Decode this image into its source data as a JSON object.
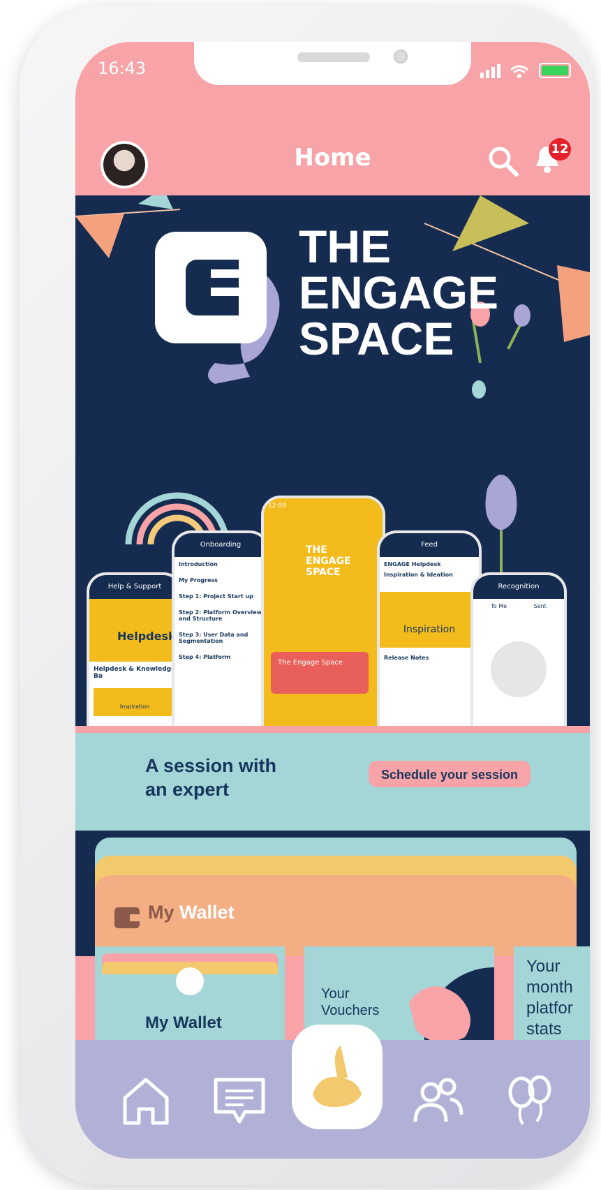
{
  "status_bar": {
    "time": "16:43",
    "battery_color": "#3bd35b"
  },
  "header": {
    "title": "Home",
    "notification_count": "12"
  },
  "hero": {
    "title_lines": [
      "THE",
      "ENGAGE",
      "SPACE"
    ],
    "mockups": [
      {
        "title": "Help & Support",
        "headline": "Helpdesk",
        "subtitle": "Helpdesk & Knowledge Ba",
        "note": "Inspiration"
      },
      {
        "title": "Onboarding",
        "items": [
          "Introduction",
          "My Progress",
          "Step 1: Project Start up",
          "Step 2: Platform Overview and Structure",
          "Step 3: User Data and Segmentation",
          "Step 4: Platform"
        ]
      },
      {
        "title": "12:09",
        "brand_lines": [
          "THE",
          "ENGAGE",
          "SPACE"
        ],
        "promo": "The Engage Space"
      },
      {
        "title": "Feed",
        "author": "ENGAGE Helpdesk",
        "topic": "Inspiration & Ideation",
        "card_label": "Inspiration",
        "topic2": "Release Notes"
      },
      {
        "title": "Recognition",
        "tabs": [
          "To Me",
          "Sent"
        ]
      }
    ]
  },
  "session": {
    "text_line1": "A session with",
    "text_line2": "an expert",
    "button_label": "Schedule your session"
  },
  "wallet": {
    "heading_prefix": "My",
    "heading_suffix": "Wallet",
    "tiles": [
      {
        "label": "My Wallet"
      },
      {
        "label_line1": "Your",
        "label_line2": "Vouchers"
      },
      {
        "label_lines": [
          "Your",
          "month",
          "platfor",
          "stats"
        ]
      }
    ]
  },
  "bottom_nav": {
    "items": [
      "home-icon",
      "chat-icon",
      "rabbit-icon",
      "people-icon",
      "balloons-icon"
    ]
  }
}
